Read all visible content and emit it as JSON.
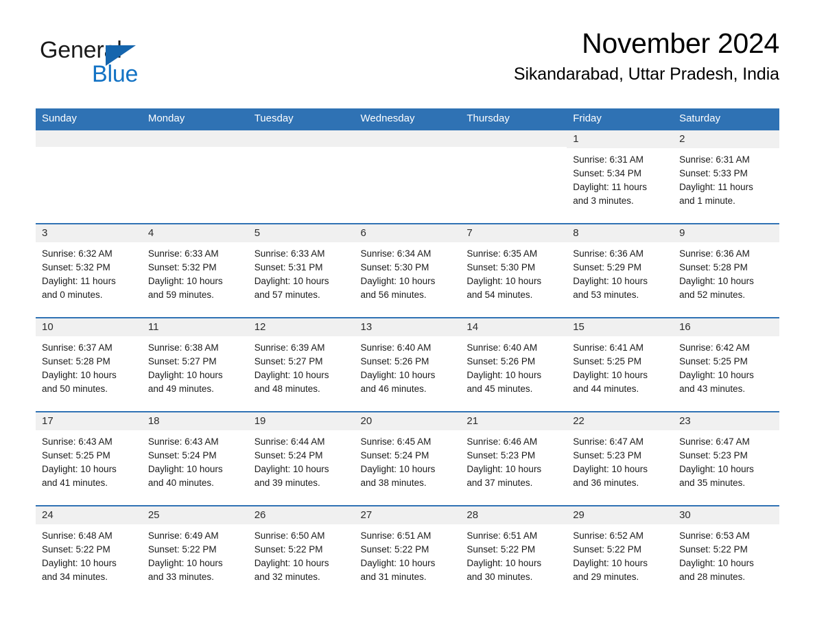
{
  "brand": {
    "name_part1": "General",
    "name_part2": "Blue",
    "accent_color": "#1272c4",
    "triangle_color": "#1565ad"
  },
  "header": {
    "title": "November 2024",
    "location": "Sikandarabad, Uttar Pradesh, India"
  },
  "theme": {
    "header_bg": "#2f72b4",
    "daynum_bg": "#f0f0f0",
    "row_rule": "#2f72b4"
  },
  "weekday_headers": [
    "Sunday",
    "Monday",
    "Tuesday",
    "Wednesday",
    "Thursday",
    "Friday",
    "Saturday"
  ],
  "weeks": [
    [
      {
        "day": "",
        "empty": true
      },
      {
        "day": "",
        "empty": true
      },
      {
        "day": "",
        "empty": true
      },
      {
        "day": "",
        "empty": true
      },
      {
        "day": "",
        "empty": true
      },
      {
        "day": "1",
        "sunrise": "Sunrise: 6:31 AM",
        "sunset": "Sunset: 5:34 PM",
        "daylight_line1": "Daylight: 11 hours",
        "daylight_line2": "and 3 minutes."
      },
      {
        "day": "2",
        "sunrise": "Sunrise: 6:31 AM",
        "sunset": "Sunset: 5:33 PM",
        "daylight_line1": "Daylight: 11 hours",
        "daylight_line2": "and 1 minute."
      }
    ],
    [
      {
        "day": "3",
        "sunrise": "Sunrise: 6:32 AM",
        "sunset": "Sunset: 5:32 PM",
        "daylight_line1": "Daylight: 11 hours",
        "daylight_line2": "and 0 minutes."
      },
      {
        "day": "4",
        "sunrise": "Sunrise: 6:33 AM",
        "sunset": "Sunset: 5:32 PM",
        "daylight_line1": "Daylight: 10 hours",
        "daylight_line2": "and 59 minutes."
      },
      {
        "day": "5",
        "sunrise": "Sunrise: 6:33 AM",
        "sunset": "Sunset: 5:31 PM",
        "daylight_line1": "Daylight: 10 hours",
        "daylight_line2": "and 57 minutes."
      },
      {
        "day": "6",
        "sunrise": "Sunrise: 6:34 AM",
        "sunset": "Sunset: 5:30 PM",
        "daylight_line1": "Daylight: 10 hours",
        "daylight_line2": "and 56 minutes."
      },
      {
        "day": "7",
        "sunrise": "Sunrise: 6:35 AM",
        "sunset": "Sunset: 5:30 PM",
        "daylight_line1": "Daylight: 10 hours",
        "daylight_line2": "and 54 minutes."
      },
      {
        "day": "8",
        "sunrise": "Sunrise: 6:36 AM",
        "sunset": "Sunset: 5:29 PM",
        "daylight_line1": "Daylight: 10 hours",
        "daylight_line2": "and 53 minutes."
      },
      {
        "day": "9",
        "sunrise": "Sunrise: 6:36 AM",
        "sunset": "Sunset: 5:28 PM",
        "daylight_line1": "Daylight: 10 hours",
        "daylight_line2": "and 52 minutes."
      }
    ],
    [
      {
        "day": "10",
        "sunrise": "Sunrise: 6:37 AM",
        "sunset": "Sunset: 5:28 PM",
        "daylight_line1": "Daylight: 10 hours",
        "daylight_line2": "and 50 minutes."
      },
      {
        "day": "11",
        "sunrise": "Sunrise: 6:38 AM",
        "sunset": "Sunset: 5:27 PM",
        "daylight_line1": "Daylight: 10 hours",
        "daylight_line2": "and 49 minutes."
      },
      {
        "day": "12",
        "sunrise": "Sunrise: 6:39 AM",
        "sunset": "Sunset: 5:27 PM",
        "daylight_line1": "Daylight: 10 hours",
        "daylight_line2": "and 48 minutes."
      },
      {
        "day": "13",
        "sunrise": "Sunrise: 6:40 AM",
        "sunset": "Sunset: 5:26 PM",
        "daylight_line1": "Daylight: 10 hours",
        "daylight_line2": "and 46 minutes."
      },
      {
        "day": "14",
        "sunrise": "Sunrise: 6:40 AM",
        "sunset": "Sunset: 5:26 PM",
        "daylight_line1": "Daylight: 10 hours",
        "daylight_line2": "and 45 minutes."
      },
      {
        "day": "15",
        "sunrise": "Sunrise: 6:41 AM",
        "sunset": "Sunset: 5:25 PM",
        "daylight_line1": "Daylight: 10 hours",
        "daylight_line2": "and 44 minutes."
      },
      {
        "day": "16",
        "sunrise": "Sunrise: 6:42 AM",
        "sunset": "Sunset: 5:25 PM",
        "daylight_line1": "Daylight: 10 hours",
        "daylight_line2": "and 43 minutes."
      }
    ],
    [
      {
        "day": "17",
        "sunrise": "Sunrise: 6:43 AM",
        "sunset": "Sunset: 5:25 PM",
        "daylight_line1": "Daylight: 10 hours",
        "daylight_line2": "and 41 minutes."
      },
      {
        "day": "18",
        "sunrise": "Sunrise: 6:43 AM",
        "sunset": "Sunset: 5:24 PM",
        "daylight_line1": "Daylight: 10 hours",
        "daylight_line2": "and 40 minutes."
      },
      {
        "day": "19",
        "sunrise": "Sunrise: 6:44 AM",
        "sunset": "Sunset: 5:24 PM",
        "daylight_line1": "Daylight: 10 hours",
        "daylight_line2": "and 39 minutes."
      },
      {
        "day": "20",
        "sunrise": "Sunrise: 6:45 AM",
        "sunset": "Sunset: 5:24 PM",
        "daylight_line1": "Daylight: 10 hours",
        "daylight_line2": "and 38 minutes."
      },
      {
        "day": "21",
        "sunrise": "Sunrise: 6:46 AM",
        "sunset": "Sunset: 5:23 PM",
        "daylight_line1": "Daylight: 10 hours",
        "daylight_line2": "and 37 minutes."
      },
      {
        "day": "22",
        "sunrise": "Sunrise: 6:47 AM",
        "sunset": "Sunset: 5:23 PM",
        "daylight_line1": "Daylight: 10 hours",
        "daylight_line2": "and 36 minutes."
      },
      {
        "day": "23",
        "sunrise": "Sunrise: 6:47 AM",
        "sunset": "Sunset: 5:23 PM",
        "daylight_line1": "Daylight: 10 hours",
        "daylight_line2": "and 35 minutes."
      }
    ],
    [
      {
        "day": "24",
        "sunrise": "Sunrise: 6:48 AM",
        "sunset": "Sunset: 5:22 PM",
        "daylight_line1": "Daylight: 10 hours",
        "daylight_line2": "and 34 minutes."
      },
      {
        "day": "25",
        "sunrise": "Sunrise: 6:49 AM",
        "sunset": "Sunset: 5:22 PM",
        "daylight_line1": "Daylight: 10 hours",
        "daylight_line2": "and 33 minutes."
      },
      {
        "day": "26",
        "sunrise": "Sunrise: 6:50 AM",
        "sunset": "Sunset: 5:22 PM",
        "daylight_line1": "Daylight: 10 hours",
        "daylight_line2": "and 32 minutes."
      },
      {
        "day": "27",
        "sunrise": "Sunrise: 6:51 AM",
        "sunset": "Sunset: 5:22 PM",
        "daylight_line1": "Daylight: 10 hours",
        "daylight_line2": "and 31 minutes."
      },
      {
        "day": "28",
        "sunrise": "Sunrise: 6:51 AM",
        "sunset": "Sunset: 5:22 PM",
        "daylight_line1": "Daylight: 10 hours",
        "daylight_line2": "and 30 minutes."
      },
      {
        "day": "29",
        "sunrise": "Sunrise: 6:52 AM",
        "sunset": "Sunset: 5:22 PM",
        "daylight_line1": "Daylight: 10 hours",
        "daylight_line2": "and 29 minutes."
      },
      {
        "day": "30",
        "sunrise": "Sunrise: 6:53 AM",
        "sunset": "Sunset: 5:22 PM",
        "daylight_line1": "Daylight: 10 hours",
        "daylight_line2": "and 28 minutes."
      }
    ]
  ]
}
